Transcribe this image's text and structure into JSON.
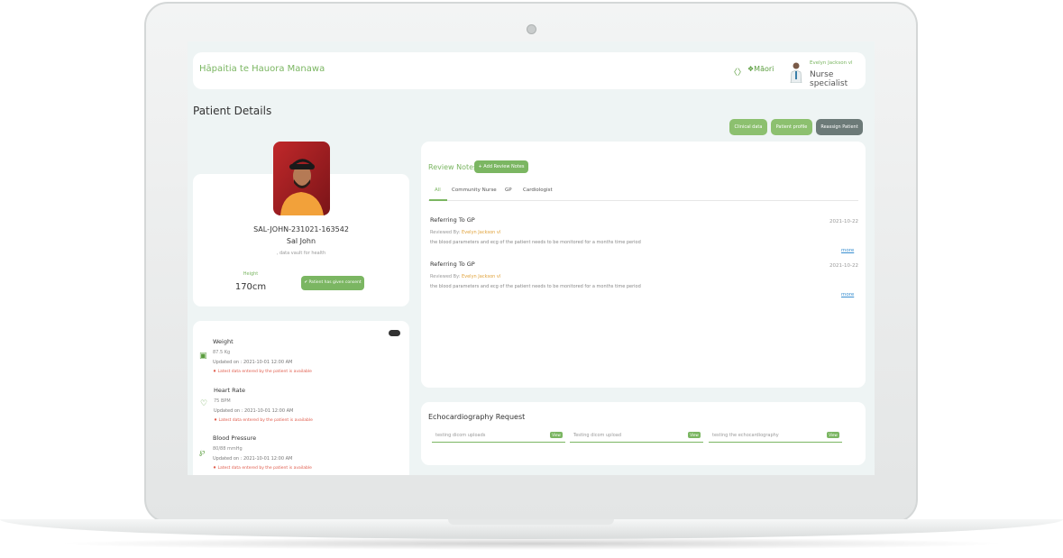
{
  "header": {
    "brand": "Hāpaitia te Hauora Manawa",
    "language": "Māori",
    "user_name": "Evelyn Jackson vl",
    "user_role": "Nurse specialist"
  },
  "page": {
    "title": "Patient Details",
    "actions": {
      "clinical_data": "Clinical data",
      "patient_profile": "Patient profile",
      "reassign_patient": "Reassign Patient"
    }
  },
  "patient": {
    "id": "SAL-JOHN-231021-163542",
    "name": "Sal John",
    "tagline": ", data vault for health",
    "height_label": "Height",
    "height_value": "170cm",
    "consent_label": "Patient has given consent"
  },
  "vitals": [
    {
      "title": "Weight",
      "value": "87.5 Kg",
      "updated": "Updated on : 2021-10-01 12:00 AM",
      "alert": "Latest data entered by the patient is available",
      "icon": "weight-icon"
    },
    {
      "title": "Heart Rate",
      "value": "75 BPM",
      "updated": "Updated on : 2021-10-01 12:00 AM",
      "alert": "Latest data entered by the patient is available",
      "icon": "heart-icon"
    },
    {
      "title": "Blood Pressure",
      "value": "80/88 mmHg",
      "updated": "Updated on : 2021-10-01 12:00 AM",
      "alert": "Latest data entered by the patient is available",
      "icon": "stethoscope-icon"
    }
  ],
  "review_notes": {
    "title": "Review Notes",
    "add_button": "+ Add Review Notes",
    "tabs": [
      "All",
      "Community Nurse",
      "GP",
      "Cardiologist"
    ],
    "active_tab": "All",
    "notes": [
      {
        "title": "Referring To GP",
        "date": "2021-10-22",
        "reviewed_by_label": "Reviewed By:",
        "reviewer": "Evelyn Jackson vl",
        "text": "the blood parameters and ecg of the patient needs to be monitored for a months time period",
        "more": "more"
      },
      {
        "title": "Referring To GP",
        "date": "2021-10-22",
        "reviewed_by_label": "Reviewed By:",
        "reviewer": "Evelyn Jackson vl",
        "text": "the blood parameters and ecg of the patient needs to be monitored for a months time period",
        "more": "more"
      }
    ]
  },
  "echo": {
    "title": "Echocardiography Request",
    "items": [
      {
        "label": "testing dicom uploads",
        "action": "View"
      },
      {
        "label": "Testing dicom upload",
        "action": "View"
      },
      {
        "label": "testing the echocardiography",
        "action": "View"
      }
    ]
  },
  "colors": {
    "accent": "#7bb662",
    "dark_button": "#6c7a78",
    "alert": "#e05a4a",
    "link": "#3a8fd0"
  }
}
